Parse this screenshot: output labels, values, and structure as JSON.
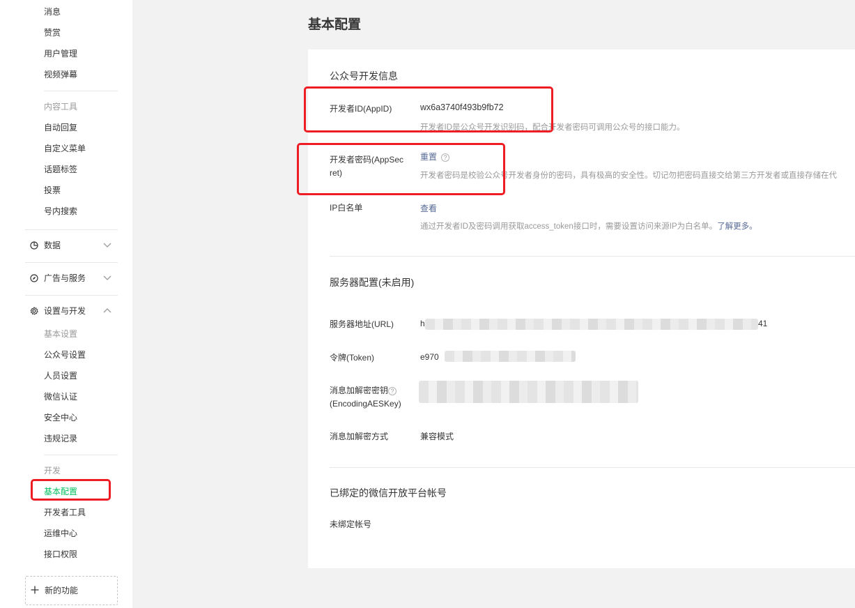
{
  "sidebar": {
    "items_top": [
      "消息",
      "赞赏",
      "用户管理",
      "视频弹幕"
    ],
    "content_tools": {
      "title": "内容工具",
      "items": [
        "自动回复",
        "自定义菜单",
        "话题标签",
        "投票",
        "号内搜索"
      ]
    },
    "sections": {
      "data": "数据",
      "ads": "广告与服务",
      "settings": "设置与开发"
    },
    "basic_settings": {
      "title": "基本设置",
      "items": [
        "公众号设置",
        "人员设置",
        "微信认证",
        "安全中心",
        "违规记录"
      ]
    },
    "dev": {
      "title": "开发",
      "items": [
        "基本配置",
        "开发者工具",
        "运维中心",
        "接口权限"
      ]
    },
    "new_feature": "新的功能"
  },
  "page_title": "基本配置",
  "dev_info": {
    "heading": "公众号开发信息",
    "appid_label": "开发者ID(AppID)",
    "appid_value": "wx6a3740f493b9fb72",
    "appid_tip": "开发者ID是公众号开发识别码，配合开发者密码可调用公众号的接口能力。",
    "secret_label_1": "开发者密码(AppSec",
    "secret_label_2": "ret)",
    "secret_action": "重置",
    "secret_tip": "开发者密码是校验公众号开发者身份的密码，具有极高的安全性。切记勿把密码直接交给第三方开发者或直接存储在代",
    "ip_label": "IP白名单",
    "ip_action": "查看",
    "ip_tip": "通过开发者ID及密码调用获取access_token接口时，需要设置访问来源IP为白名单。",
    "ip_tip_link": "了解更多。"
  },
  "server": {
    "heading": "服务器配置(未启用)",
    "url_label": "服务器地址(URL)",
    "url_prefix": "h",
    "url_suffix": "41",
    "token_label": "令牌(Token)",
    "token_prefix": "e970",
    "aes_label_1": "消息加解密密钥",
    "aes_label_2": "(EncodingAESKey)",
    "mode_label": "消息加解密方式",
    "mode_value": "兼容模式"
  },
  "open_platform": {
    "heading": "已绑定的微信开放平台帐号",
    "value": "未绑定帐号"
  },
  "colors": {
    "accent_green": "#07c160",
    "link_blue": "#576b95",
    "highlight_red": "#ee1d24"
  }
}
